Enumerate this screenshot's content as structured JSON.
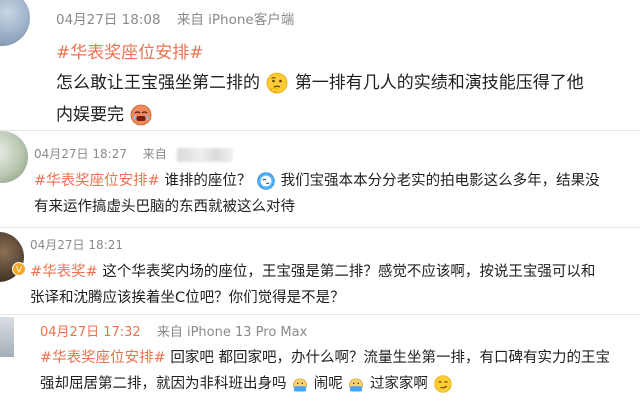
{
  "comments": [
    {
      "date": "04月27日",
      "time": "18:08",
      "source": "来自 iPhone客户端",
      "tag": "#华表奖座位安排#",
      "line1": "怎么敢让王宝强坐第二排的",
      "line1b": "第一排有几人的实绩和演技能压得了他",
      "line2": "内娱要完"
    },
    {
      "date": "04月27日",
      "time": "18:27",
      "source": "来自",
      "tag": "#华表奖座位安排#",
      "line1": "谁排的座位？",
      "line1b": "我们宝强本本分分老实的拍电影这么多年，结果没",
      "line2": "有来运作搞虚头巴脑的东西就被这么对待"
    },
    {
      "date": "04月27日",
      "time": "18:21",
      "tag": "#华表奖#",
      "line1": "这个华表奖内场的座位，王宝强是第二排？感觉不应该啊，按说王宝强可以和",
      "line2": "张译和沈腾应该挨着坐C位吧？你们觉得是不是？"
    },
    {
      "date": "04月27日",
      "time": "17:32",
      "source": "来自 iPhone 13 Pro Max",
      "tag": "#华表奖座位安排#",
      "line1": "回家吧 都回家吧，办什么啊？流量生坐第一排，有口碑有实力的王宝",
      "line2a": "强却屈居第二排，就因为非科班出身吗",
      "line2b": "闹呢",
      "line2c": "过家家啊"
    }
  ]
}
